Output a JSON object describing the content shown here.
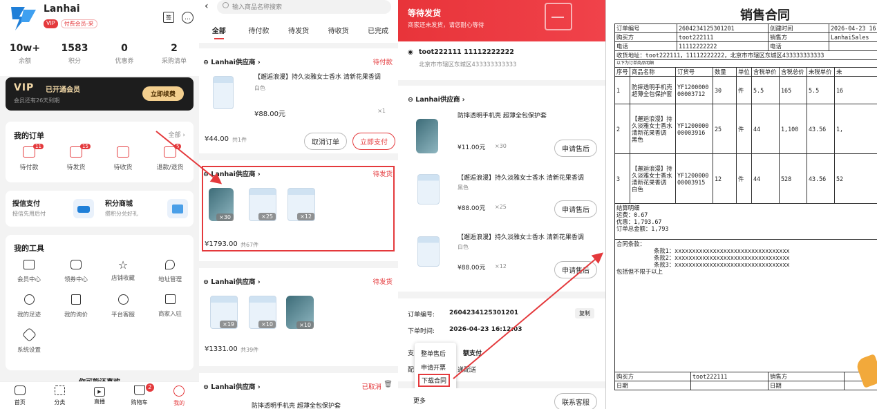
{
  "mine": {
    "app_name": "Lanhai",
    "vip_badge": "VIP",
    "member_tag": "付费会员-采",
    "stats": [
      {
        "value": "10w+",
        "label": "余额"
      },
      {
        "value": "1583",
        "label": "积分"
      },
      {
        "value": "0",
        "label": "优惠券"
      },
      {
        "value": "2",
        "label": "采购清单"
      }
    ],
    "vip_title": "已开通会员",
    "vip_logo": "VIP",
    "vip_sub": "会员还有26天到期",
    "vip_renew": "立即续费",
    "orders_title": "我的订单",
    "orders_all": "全部 ›",
    "order_icons": [
      {
        "label": "待付款",
        "badge": "11"
      },
      {
        "label": "待发货",
        "badge": "15"
      },
      {
        "label": "待收货",
        "badge": ""
      },
      {
        "label": "退款/退货",
        "badge": "5"
      }
    ],
    "credit_title": "授信支付",
    "credit_sub": "授信先用后付",
    "points_title": "积分商城",
    "points_sub": "攒积分兑好礼",
    "tools_title": "我的工具",
    "tools": [
      "会员中心",
      "领券中心",
      "店铺收藏",
      "地址管理",
      "我的足迹",
      "我的询价",
      "平台客服",
      "商家入驻",
      "系统设置"
    ],
    "guess": "你可能还喜欢",
    "tabbar": [
      {
        "label": "首页"
      },
      {
        "label": "分类"
      },
      {
        "label": "直播"
      },
      {
        "label": "购物车",
        "badge": "2"
      },
      {
        "label": "我的"
      }
    ]
  },
  "orders": {
    "search_placeholder": "输入商品名称搜索",
    "tabs": [
      "全部",
      "待付款",
      "待发货",
      "待收货",
      "已完成"
    ],
    "o1": {
      "shop": "Lanhai供应商 ›",
      "status": "待付款",
      "title": "【邂逅浪漫】持久淡雅女士香水 清新花果香调",
      "spec": "白色",
      "price": "¥88.00元",
      "count": "×1",
      "total": "¥44.00",
      "total_note": "共1件",
      "btn1": "取消订单",
      "btn2": "立即支付"
    },
    "o2": {
      "shop": "Lanhai供应商 ›",
      "status": "待发货",
      "qtys": [
        "×30",
        "×25",
        "×12"
      ],
      "total": "¥1793.00",
      "total_note": "共67件"
    },
    "o3": {
      "shop": "Lanhai供应商 ›",
      "status": "待发货",
      "qtys": [
        "×19",
        "×10",
        "×10"
      ],
      "total": "¥1331.00",
      "total_note": "共39件"
    },
    "o4": {
      "shop": "Lanhai供应商 ›",
      "status": "已取消",
      "title": "防摔透明手机壳 超薄全包保护套"
    }
  },
  "detail": {
    "status_title": "等待发货",
    "status_sub": "商家还未发货，请您耐心等待",
    "address_name": "toot222111  11112222222",
    "address": "北京市市辖区东城区433333333333",
    "shop": "Lanhai供应商 ›",
    "items": [
      {
        "title": "防摔透明手机壳 超薄全包保护套",
        "spec": "",
        "price": "¥11.00元",
        "count": "×30",
        "btn": "申请售后"
      },
      {
        "title": "【邂逅浪漫】持久淡雅女士香水 清新花果香调",
        "spec": "黑色",
        "price": "¥88.00元",
        "count": "×25",
        "btn": "申请售后"
      },
      {
        "title": "【邂逅浪漫】持久淡雅女士香水 清新花果香调",
        "spec": "白色",
        "price": "¥88.00元",
        "count": "×12",
        "btn": "申请售后"
      }
    ],
    "order_no_label": "订单编号:",
    "order_no": "2604234125301201",
    "copy": "复制",
    "time_label": "下单时间:",
    "time": "2026-04-23 16:12:03",
    "pay_label": "支",
    "pay_value": "额支付",
    "deliver_label": "配",
    "deliver_value": "递配送",
    "popup": [
      "整单售后",
      "申请开票",
      "下载合同"
    ],
    "more": "更多",
    "service": "联系客服"
  },
  "contract": {
    "title": "销售合同",
    "r1": [
      "订单编号",
      "2604234125301201",
      "创建时间",
      "2026-04-23 16"
    ],
    "r2": [
      "购买方",
      "toot222111",
      "销售方",
      "LanhaiSales"
    ],
    "r3": [
      "电话",
      "11112222222",
      "电话",
      ""
    ],
    "address_line": "收货地址：toot222111，11112222222，北京市市辖区东城区433333333333",
    "list_note": "以下为订单商品明细",
    "head": [
      "序号",
      "商品名称",
      "订货号",
      "数量",
      "单位",
      "含税单价",
      "含税总价",
      "未税单价",
      "未"
    ],
    "rows": [
      [
        "1",
        "防摔透明手机壳 超薄全包保护套",
        "YF120000000003712",
        "30",
        "件",
        "5.5",
        "165",
        "5.5",
        "16"
      ],
      [
        "2",
        "【邂逅浪漫】持久淡雅女士香水 清新花果香调 黑色",
        "YF120000000003916",
        "25",
        "件",
        "44",
        "1,100",
        "43.56",
        "1,"
      ],
      [
        "3",
        "【邂逅浪漫】持久淡雅女士香水 清新花果香调 白色",
        "YF120000000003915",
        "12",
        "件",
        "44",
        "528",
        "43.56",
        "52"
      ]
    ],
    "summary": [
      "结算明细",
      "运费：0.67",
      "优惠：1,793.67",
      "订单总金额：1,793"
    ],
    "terms_title": "合同条款：",
    "terms": [
      "条款1：xxxxxxxxxxxxxxxxxxxxxxxxxxxxxxxxx",
      "条款2：xxxxxxxxxxxxxxxxxxxxxxxxxxxxxxxxx",
      "条款3：xxxxxxxxxxxxxxxxxxxxxxxxxxxxxxxxx"
    ],
    "terms_note": "包括但不限于以上",
    "sign1": [
      "购买方",
      "toot222111",
      "销售方",
      ""
    ],
    "sign2": [
      "日期",
      "",
      "日期",
      ""
    ]
  }
}
